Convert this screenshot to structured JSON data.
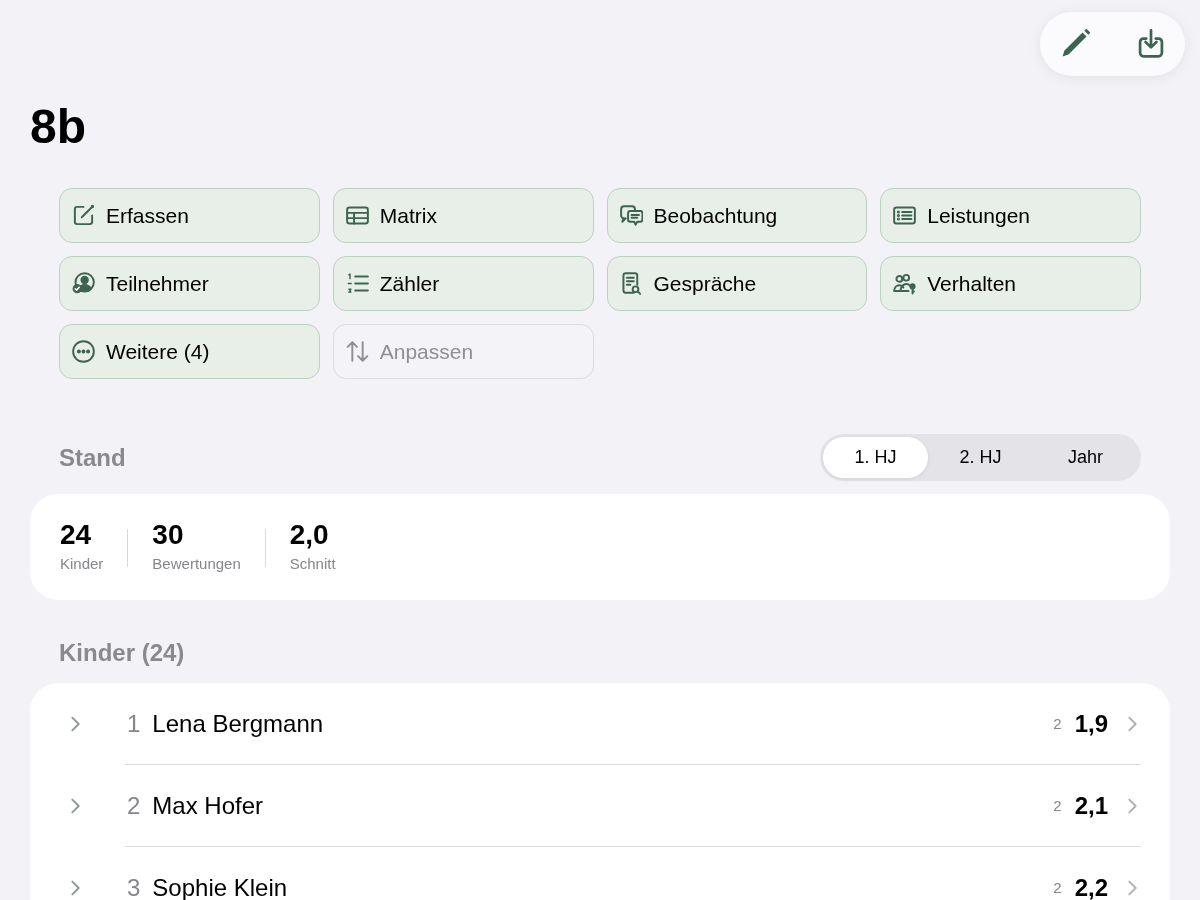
{
  "title": "8b",
  "actions": [
    {
      "label": "Erfassen",
      "disabled": false
    },
    {
      "label": "Matrix",
      "disabled": false
    },
    {
      "label": "Beobachtung",
      "disabled": false
    },
    {
      "label": "Leistungen",
      "disabled": false
    },
    {
      "label": "Teilnehmer",
      "disabled": false
    },
    {
      "label": "Zähler",
      "disabled": false
    },
    {
      "label": "Gespräche",
      "disabled": false
    },
    {
      "label": "Verhalten",
      "disabled": false
    },
    {
      "label": "Weitere (4)",
      "disabled": false
    },
    {
      "label": "Anpassen",
      "disabled": true
    }
  ],
  "stand": {
    "heading": "Stand",
    "periods": [
      {
        "label": "1. HJ",
        "selected": true
      },
      {
        "label": "2. HJ",
        "selected": false
      },
      {
        "label": "Jahr",
        "selected": false
      }
    ],
    "stats": [
      {
        "value": "24",
        "label": "Kinder"
      },
      {
        "value": "30",
        "label": "Bewertungen"
      },
      {
        "value": "2,0",
        "label": "Schnitt"
      }
    ]
  },
  "kinder_list": {
    "heading": "Kinder (24)",
    "rows": [
      {
        "number": "1",
        "name": "Lena Bergmann",
        "count": "2",
        "grade": "1,9",
        "expanded": false
      },
      {
        "number": "2",
        "name": "Max Hofer",
        "count": "2",
        "grade": "2,1",
        "expanded": false
      },
      {
        "number": "3",
        "name": "Sophie Klein",
        "count": "2",
        "grade": "2,2",
        "expanded": false
      }
    ]
  }
}
